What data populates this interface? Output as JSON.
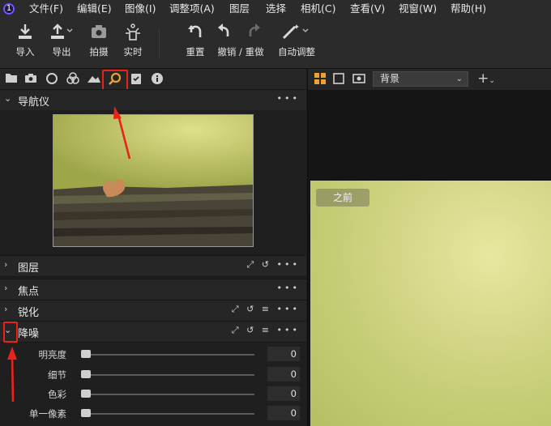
{
  "menu": {
    "items": [
      "文件(F)",
      "编辑(E)",
      "图像(I)",
      "调整项(A)",
      "图层",
      "选择",
      "相机(C)",
      "查看(V)",
      "视窗(W)",
      "帮助(H)"
    ]
  },
  "toolbar": {
    "import": "导入",
    "export": "导出",
    "capture": "拍摄",
    "live": "实时",
    "reset": "重置",
    "undo_redo": "撤销 / 重做",
    "auto_adjust": "自动调整"
  },
  "viewer": {
    "layer_select": "背景",
    "before_label": "之前"
  },
  "panels": {
    "navigator": "导航仪",
    "layers": "图层",
    "focus": "焦点",
    "sharpen": "锐化",
    "noise_reduction": "降噪"
  },
  "noise_reduction": {
    "sliders": [
      {
        "label": "明亮度",
        "value": "0"
      },
      {
        "label": "细节",
        "value": "0"
      },
      {
        "label": "色彩",
        "value": "0"
      },
      {
        "label": "单一像素",
        "value": "0"
      }
    ]
  },
  "icons": {
    "app": "app-logo-icon",
    "annotation_color": "#e8231c"
  }
}
